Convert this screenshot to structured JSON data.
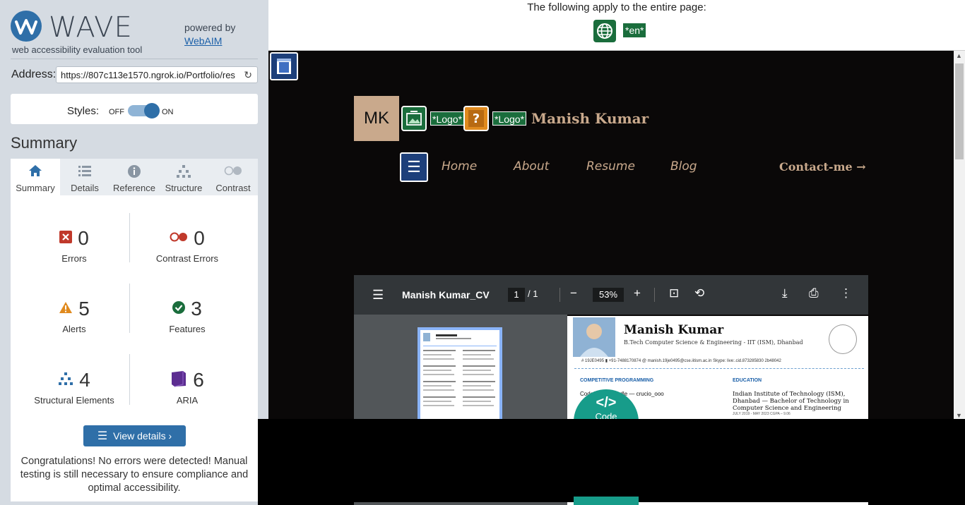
{
  "wave": {
    "brand": "WAVE",
    "tagline": "web accessibility evaluation tool",
    "powered_by": "powered by",
    "webaim": "WebAIM",
    "address_label": "Address:",
    "address_value": "https://807c113e1570.ngrok.io/Portfolio/res",
    "styles_label": "Styles:",
    "styles_off": "OFF",
    "styles_on": "ON",
    "summary_title": "Summary",
    "tabs": [
      {
        "label": "Summary",
        "icon": "home-icon"
      },
      {
        "label": "Details",
        "icon": "list-icon"
      },
      {
        "label": "Reference",
        "icon": "info-icon"
      },
      {
        "label": "Structure",
        "icon": "hierarchy-icon"
      },
      {
        "label": "Contrast",
        "icon": "contrast-icon"
      }
    ],
    "stats": {
      "errors": {
        "count": "0",
        "label": "Errors"
      },
      "contrast_errors": {
        "count": "0",
        "label": "Contrast Errors"
      },
      "alerts": {
        "count": "5",
        "label": "Alerts"
      },
      "features": {
        "count": "3",
        "label": "Features"
      },
      "structural": {
        "count": "4",
        "label": "Structural Elements"
      },
      "aria": {
        "count": "6",
        "label": "ARIA"
      }
    },
    "view_details": "View details ›",
    "congrats": "Congratulations! No errors were detected! Manual testing is still necessary to ensure compliance and optimal accessibility."
  },
  "topbar": {
    "apply_text": "The following apply to the entire page:",
    "lang_tag": "*en*"
  },
  "site": {
    "initials": "MK",
    "logo_tag_1": "*Logo*",
    "logo_tag_2": "*Logo*",
    "brand_name": "Manish Kumar",
    "nav": [
      "Home",
      "About",
      "Resume",
      "Blog"
    ],
    "contact": "Contact-me →"
  },
  "pdf": {
    "title": "Manish Kumar_CV",
    "page_current": "1",
    "page_sep_total": "/   1",
    "zoom": "53%",
    "cv_name": "Manish Kumar",
    "cv_subtitle": "B.Tech Computer Science & Engineering - IIT (ISM), Dhanbad",
    "cv_contacts": "# 19JE0495      ▮ +91-7488170874        @ manish.19je0495@cse.iitism.ac.in                          Skype: live:.cid.873285830 2b48042",
    "section_left": "COMPETITIVE PROGRAMMING",
    "section_right": "EDUCATION",
    "cf_line": "Codeforces handle — crucio_ooo",
    "institute": "Indian Institute of Technology (ISM), Dhanbad — Bachelor of Technology in Computer Science and Engineering",
    "dates": "JULY 2019 - MAY 2023        CGPA – 9.06",
    "code_badge_glyph": "</>",
    "code_badge_label": "Code"
  },
  "colors": {
    "sidebar_bg": "#d5dbe2",
    "wave_blue": "#2f6fa8",
    "feature_green": "#1a6d3c",
    "site_bg": "#0a0808",
    "accent_tan": "#c9a98c",
    "error_red": "#c0392b",
    "alert_orange": "#e08a1e",
    "aria_purple": "#5c2d91"
  }
}
